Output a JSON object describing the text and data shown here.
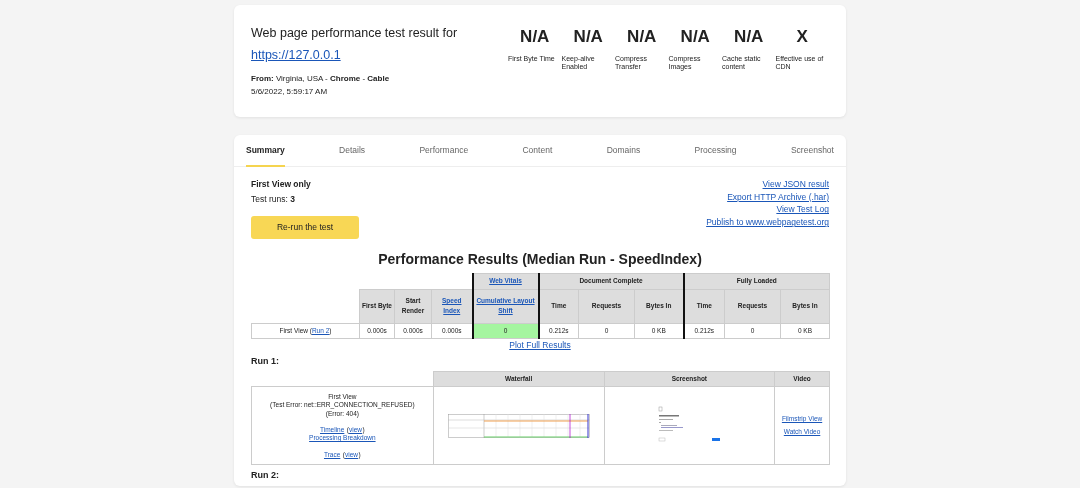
{
  "header": {
    "title": "Web page performance test result for",
    "url": "https://127.0.0.1",
    "from": "**From:** Virginia, USA - **Chrome** - **Cable**",
    "date": "5/6/2022, 5:59:17 AM"
  },
  "metrics": [
    {
      "value": "N/A",
      "label": "First Byte Time"
    },
    {
      "value": "N/A",
      "label": "Keep-alive Enabled"
    },
    {
      "value": "N/A",
      "label": "Compress Transfer"
    },
    {
      "value": "N/A",
      "label": "Compress Images"
    },
    {
      "value": "N/A",
      "label": "Cache static content"
    },
    {
      "value": "X",
      "label": "Effective use of CDN"
    }
  ],
  "tabs": [
    {
      "label": "Summary",
      "selected": true
    },
    {
      "label": "Details",
      "selected": false
    },
    {
      "label": "Performance",
      "selected": false
    },
    {
      "label": "Content",
      "selected": false
    },
    {
      "label": "Domains",
      "selected": false
    },
    {
      "label": "Processing",
      "selected": false
    },
    {
      "label": "Screenshot",
      "selected": false
    }
  ],
  "summary": {
    "heading": "First View only",
    "runs": "Test runs: **3**",
    "button": "Re-run the test",
    "links": [
      "View JSON result",
      "Export HTTP Archive (.har)",
      "View Test Log",
      "Publish to www.webpagetest.org"
    ]
  },
  "results": {
    "title": "Performance Results (Median Run - SpeedIndex)",
    "groups": [
      {
        "columns": [
          {
            "label": "First Byte",
            "link": false
          },
          {
            "label": "Start Render",
            "link": false
          },
          {
            "label": "Speed Index",
            "link": true
          }
        ]
      },
      {
        "title": "Web Vitals",
        "link": true,
        "columns": [
          {
            "label": "Cumulative Layout Shift",
            "link": true
          }
        ]
      },
      {
        "title": "Document Complete",
        "link": false,
        "columns": [
          {
            "label": "Time",
            "link": false
          },
          {
            "label": "Requests",
            "link": false
          },
          {
            "label": "Bytes In",
            "link": false
          }
        ]
      },
      {
        "title": "Fully Loaded",
        "link": false,
        "columns": [
          {
            "label": "Time",
            "link": false
          },
          {
            "label": "Requests",
            "link": false
          },
          {
            "label": "Bytes In",
            "link": false
          }
        ]
      }
    ],
    "row": {
      "prefix": "First View (",
      "link": "Run 2",
      "suffix": ")",
      "cells": [
        {
          "text": "0.000s",
          "good": false
        },
        {
          "text": "0.000s",
          "good": false
        },
        {
          "text": "0.000s",
          "good": false
        },
        {
          "text": "0",
          "good": true
        },
        {
          "text": "0.212s",
          "good": false
        },
        {
          "text": "0",
          "good": false
        },
        {
          "text": "0 KB",
          "good": false
        },
        {
          "text": "0.212s",
          "good": false
        },
        {
          "text": "0",
          "good": false
        },
        {
          "text": "0 KB",
          "good": false
        }
      ]
    },
    "plot_link": "Plot Full Results"
  },
  "runs": [
    {
      "title": "Run 1:",
      "columns": [
        "Waterfall",
        "Screenshot",
        "Video"
      ],
      "info": [
        {
          "kind": "text",
          "text": "First View"
        },
        {
          "kind": "text",
          "text": "(Test Error: net::ERR_CONNECTION_REFUSED)"
        },
        {
          "kind": "text",
          "text": "(Error: 404)"
        },
        {
          "kind": "spacer"
        },
        {
          "kind": "link_pair",
          "main": "Timeline",
          "open": "(",
          "extra": "view",
          "close": ")"
        },
        {
          "kind": "link",
          "text": "Processing Breakdown"
        },
        {
          "kind": "spacer"
        },
        {
          "kind": "link_pair",
          "main": "Trace",
          "open": "(",
          "extra": "view",
          "close": ")"
        }
      ],
      "video_links": [
        "Filmstrip View",
        "Watch Video"
      ]
    },
    {
      "title": "Run 2:"
    }
  ]
}
